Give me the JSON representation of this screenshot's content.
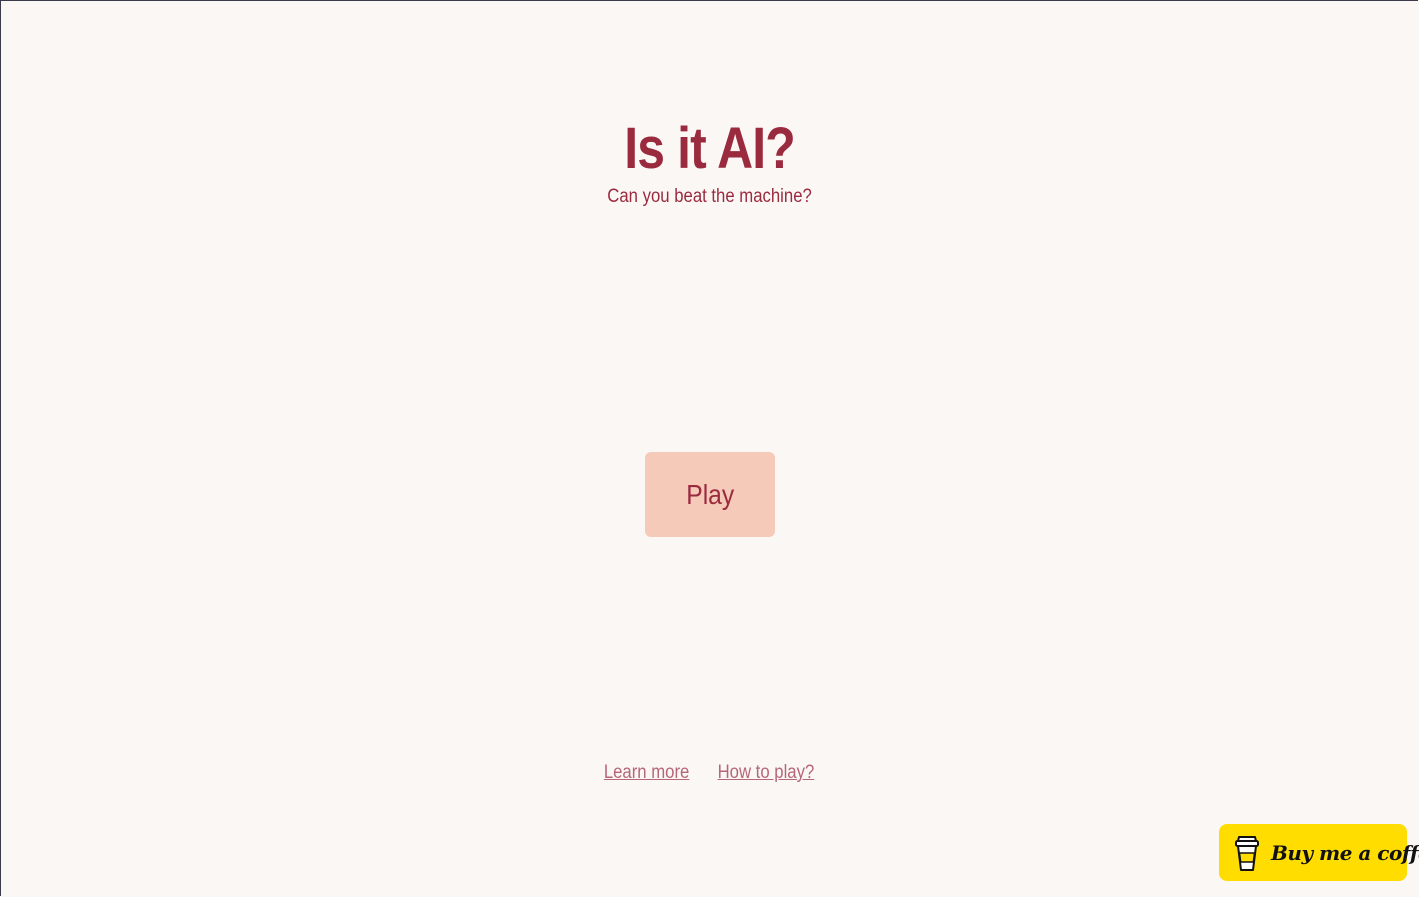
{
  "header": {
    "title": "Is it AI?",
    "subtitle": "Can you beat the machine?"
  },
  "main": {
    "play_label": "Play"
  },
  "footer": {
    "learn_more": "Learn more",
    "how_to_play": "How to play?"
  },
  "coffee_widget": {
    "label": "Buy me a coffee",
    "icon": "coffee-cup-icon",
    "background": "#ffdd00"
  },
  "colors": {
    "background": "#fbf7f5",
    "accent": "#9a2a3e",
    "button_bg": "#f6cab9",
    "link": "#b56677"
  }
}
